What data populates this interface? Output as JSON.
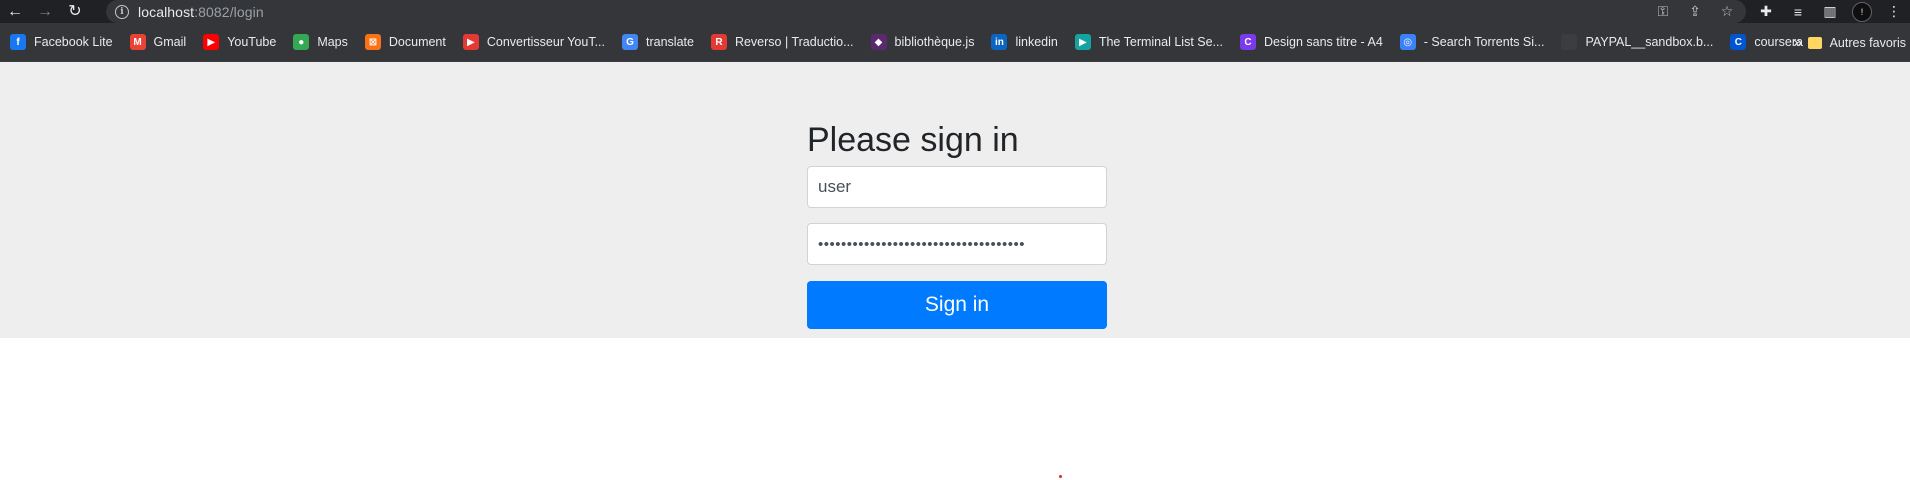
{
  "browser": {
    "url_host": "localhost",
    "url_rest": ":8082/login",
    "bookmarks": [
      {
        "label": "Facebook Lite",
        "icon": "facebook-icon",
        "color": "#1877f2",
        "glyph": "f"
      },
      {
        "label": "Gmail",
        "icon": "gmail-icon",
        "color": "#ea4335",
        "glyph": "M"
      },
      {
        "label": "YouTube",
        "icon": "youtube-icon",
        "color": "#ff0000",
        "glyph": "▶"
      },
      {
        "label": "Maps",
        "icon": "maps-icon",
        "color": "#34a853",
        "glyph": "●"
      },
      {
        "label": "Document",
        "icon": "document-icon",
        "color": "#f97316",
        "glyph": "⊠"
      },
      {
        "label": "Convertisseur YouT...",
        "icon": "converter-icon",
        "color": "#e53935",
        "glyph": "▶"
      },
      {
        "label": "translate",
        "icon": "translate-icon",
        "color": "#4285f4",
        "glyph": "G"
      },
      {
        "label": "Reverso | Traductio...",
        "icon": "reverso-icon",
        "color": "#e53935",
        "glyph": "R"
      },
      {
        "label": "bibliothèque.js",
        "icon": "library-icon",
        "color": "#5b2a6e",
        "glyph": "◆"
      },
      {
        "label": "linkedin",
        "icon": "linkedin-icon",
        "color": "#0a66c2",
        "glyph": "in"
      },
      {
        "label": "The Terminal List Se...",
        "icon": "terminal-list-icon",
        "color": "#14a3a0",
        "glyph": "▶"
      },
      {
        "label": "Design sans titre - A4",
        "icon": "canva-icon",
        "color": "#7c3aed",
        "glyph": "C"
      },
      {
        "label": "- Search Torrents Si...",
        "icon": "torrents-icon",
        "color": "#3b82f6",
        "glyph": "◎"
      },
      {
        "label": "PAYPAL__sandbox.b...",
        "icon": "paypal-icon",
        "color": "#3c3d40",
        "glyph": ""
      },
      {
        "label": "coursera",
        "icon": "coursera-icon",
        "color": "#0056d2",
        "glyph": "C"
      }
    ],
    "other_bookmarks": "Autres favoris"
  },
  "login": {
    "heading": "Please sign in",
    "username_value": "user",
    "password_value": "••••••••••••••••••••••••••••••••••••",
    "submit_label": "Sign in"
  },
  "colors": {
    "band_bg": "#eeeeee",
    "primary": "#007bff"
  }
}
